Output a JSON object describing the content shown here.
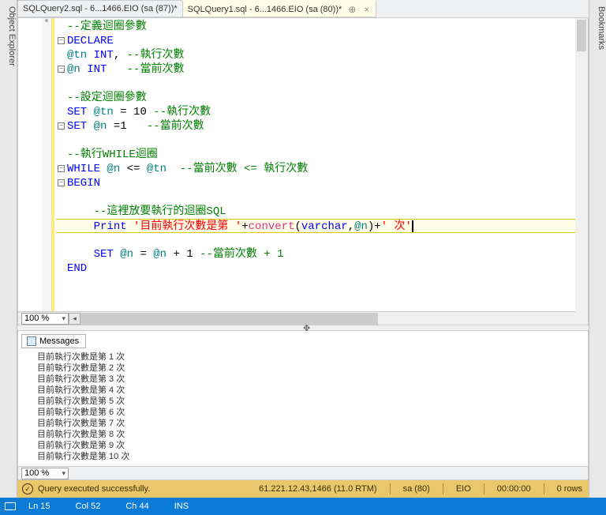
{
  "siderails": {
    "left": "Object Explorer",
    "right": "Bookmarks"
  },
  "tabs": [
    {
      "label": "SQLQuery2.sql - 6...1466.EIO (sa (87))*",
      "active": false
    },
    {
      "label": "SQLQuery1.sql - 6...1466.EIO (sa (80))*",
      "active": true
    }
  ],
  "editor": {
    "zoom": "100 %",
    "lines": [
      {
        "fold": "",
        "html": "<span class='c-comment'>--定義迴圈參數</span>"
      },
      {
        "fold": "⊟",
        "html": "<span class='c-keyword'>DECLARE</span>"
      },
      {
        "fold": "",
        "html": "<span class='c-var'>@tn</span> <span class='c-keyword'>INT</span>, <span class='c-comment'>--執行次數</span>"
      },
      {
        "fold": "⊟",
        "html": "<span class='c-var'>@n</span> <span class='c-keyword'>INT</span>   <span class='c-comment'>--當前次數</span>"
      },
      {
        "fold": "",
        "html": ""
      },
      {
        "fold": "",
        "html": "<span class='c-comment'>--設定迴圈參數</span>"
      },
      {
        "fold": "",
        "html": "<span class='c-keyword'>SET</span> <span class='c-var'>@tn</span> = 10 <span class='c-comment'>--執行次數</span>"
      },
      {
        "fold": "⊟",
        "html": "<span class='c-keyword'>SET</span> <span class='c-var'>@n</span> =1   <span class='c-comment'>--當前次數</span>"
      },
      {
        "fold": "",
        "html": ""
      },
      {
        "fold": "",
        "html": "<span class='c-comment'>--執行WHILE迴圈</span>"
      },
      {
        "fold": "⊟",
        "html": "<span class='c-keyword'>WHILE</span> <span class='c-var'>@n</span> &lt;= <span class='c-var'>@tn</span>  <span class='c-comment'>--當前次數 &lt;= 執行次數</span>"
      },
      {
        "fold": "⊟",
        "html": "<span class='c-keyword'>BEGIN</span>"
      },
      {
        "fold": "",
        "html": ""
      },
      {
        "fold": "",
        "html": "    <span class='c-comment'>--這裡放要執行的迴圈SQL</span>"
      },
      {
        "fold": "",
        "hl": true,
        "html": "    <span class='c-keyword'>Print</span> <span class='c-string'>'目前執行次數是第 '</span>+<span class='c-func'>convert</span>(<span class='c-keyword'>varchar</span>,<span class='c-var'>@n</span>)+<span class='c-string'>' 次'</span><span class='cursor-caret'></span>"
      },
      {
        "fold": "",
        "html": ""
      },
      {
        "fold": "",
        "html": "    <span class='c-keyword'>SET</span> <span class='c-var'>@n</span> = <span class='c-var'>@n</span> + 1 <span class='c-comment'>--當前次數 + 1</span>"
      },
      {
        "fold": "",
        "html": "<span class='c-keyword'>END</span>"
      }
    ]
  },
  "messages": {
    "tab_label": "Messages",
    "zoom": "100 %",
    "rows": [
      "目前執行次數是第 1 次",
      "目前執行次數是第 2 次",
      "目前執行次數是第 3 次",
      "目前執行次數是第 4 次",
      "目前執行次數是第 5 次",
      "目前執行次數是第 6 次",
      "目前執行次數是第 7 次",
      "目前執行次數是第 8 次",
      "目前執行次數是第 9 次",
      "目前執行次數是第 10 次"
    ]
  },
  "status": {
    "text": "Query executed successfully.",
    "server": "61.221.12.43,1466 (11.0 RTM)",
    "user": "sa (80)",
    "db": "EIO",
    "elapsed": "00:00:00",
    "rows": "0 rows"
  },
  "bottom": {
    "ln": "Ln 15",
    "col": "Col 52",
    "ch": "Ch 44",
    "mode": "INS"
  }
}
